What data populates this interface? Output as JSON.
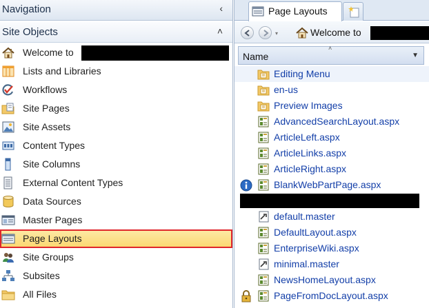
{
  "navigation": {
    "title": "Navigation",
    "collapse_glyph": "‹",
    "section": {
      "title": "Site Objects",
      "chevron_glyph": "˄"
    },
    "items": [
      {
        "label": "Welcome to",
        "icon": "home-icon"
      },
      {
        "label": "Lists and Libraries",
        "icon": "list-icon"
      },
      {
        "label": "Workflows",
        "icon": "workflow-icon"
      },
      {
        "label": "Site Pages",
        "icon": "pages-folder-icon"
      },
      {
        "label": "Site Assets",
        "icon": "image-asset-icon"
      },
      {
        "label": "Content Types",
        "icon": "content-type-icon"
      },
      {
        "label": "Site Columns",
        "icon": "column-icon"
      },
      {
        "label": "External Content Types",
        "icon": "external-content-icon"
      },
      {
        "label": "Data Sources",
        "icon": "database-icon"
      },
      {
        "label": "Master Pages",
        "icon": "master-page-icon"
      },
      {
        "label": "Page Layouts",
        "icon": "page-layout-icon",
        "selected": true
      },
      {
        "label": "Site Groups",
        "icon": "users-icon"
      },
      {
        "label": "Subsites",
        "icon": "sitemap-icon"
      },
      {
        "label": "All Files",
        "icon": "folder-icon"
      }
    ]
  },
  "tabs": {
    "active_label": "Page Layouts",
    "active_icon": "page-layout-icon",
    "new_tab_icon": "new-tab-icon"
  },
  "address": {
    "text": "Welcome to",
    "back_icon": "back-arrow-icon",
    "forward_icon": "forward-arrow-icon",
    "dropdown_glyph": "▾",
    "home_icon": "home-icon"
  },
  "list": {
    "column_header": "Name",
    "sort_glyph": "˄",
    "dropdown_glyph": "▼",
    "items": [
      {
        "name": "Editing Menu",
        "icon": "folder-icon",
        "status": ""
      },
      {
        "name": "en-us",
        "icon": "folder-icon",
        "status": ""
      },
      {
        "name": "Preview Images",
        "icon": "folder-icon",
        "status": ""
      },
      {
        "name": "AdvancedSearchLayout.aspx",
        "icon": "aspx-page-icon",
        "status": ""
      },
      {
        "name": "ArticleLeft.aspx",
        "icon": "aspx-page-icon",
        "status": ""
      },
      {
        "name": "ArticleLinks.aspx",
        "icon": "aspx-page-icon",
        "status": ""
      },
      {
        "name": "ArticleRight.aspx",
        "icon": "aspx-page-icon",
        "status": ""
      },
      {
        "name": "BlankWebPartPage.aspx",
        "icon": "aspx-page-icon",
        "status": "info-icon"
      },
      {
        "name": "",
        "icon": "",
        "status": "",
        "redacted": true
      },
      {
        "name": "default.master",
        "icon": "master-file-icon",
        "status": ""
      },
      {
        "name": "DefaultLayout.aspx",
        "icon": "aspx-page-icon",
        "status": ""
      },
      {
        "name": "EnterpriseWiki.aspx",
        "icon": "aspx-page-icon",
        "status": ""
      },
      {
        "name": "minimal.master",
        "icon": "master-file-icon",
        "status": ""
      },
      {
        "name": "NewsHomeLayout.aspx",
        "icon": "aspx-page-icon",
        "status": ""
      },
      {
        "name": "PageFromDocLayout.aspx",
        "icon": "aspx-page-icon",
        "status": "lock-icon"
      }
    ]
  },
  "colors": {
    "selection_fill": "#fbd873",
    "selection_border": "#e0262b",
    "link_text": "#123ea8",
    "pane_border": "#a9b9cf"
  }
}
